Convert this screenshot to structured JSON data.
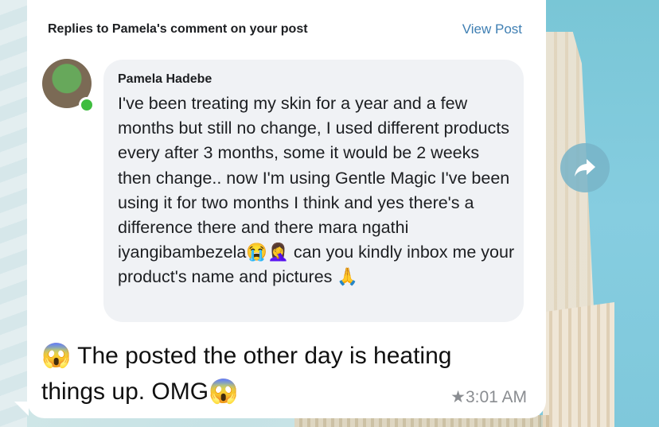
{
  "header": {
    "title": "Replies to Pamela's comment on your post",
    "view_post_label": "View Post"
  },
  "comment": {
    "author": "Pamela Hadebe",
    "text": "I've been treating my skin for a year and a few months but still no change, I used different products every after 3 months, some it would be 2 weeks then change.. now I'm using Gentle Magic I've been using it for two months I think and yes there's a difference there and there mara ngathi iyangibambezela😭🤦‍♀️ can you kindly inbox me your product's name and pictures 🙏"
  },
  "message": {
    "text": "😱 The posted the other day is heating things up. OMG😱",
    "star": "★",
    "time": "3:01 AM"
  },
  "icons": {
    "avatar": "profile-photo",
    "online": "online-status-dot",
    "forward": "share-forward-icon"
  },
  "colors": {
    "link": "#3f7fb3",
    "comment_bg": "#f0f2f5",
    "online": "#3fbd3f"
  }
}
